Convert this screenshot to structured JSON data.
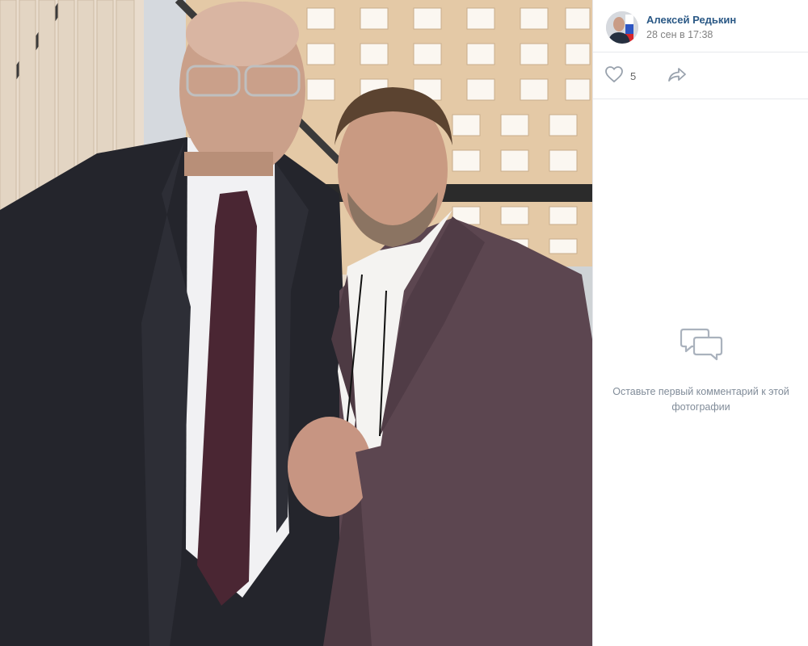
{
  "post": {
    "author_name": "Алексей Редькин",
    "date": "28 сен в 17:38",
    "likes": "5"
  },
  "comments": {
    "empty_text": "Оставьте первый комментарий к этой фотографии"
  },
  "icons": {
    "like": "heart-icon",
    "share": "share-arrow-icon",
    "empty_comments": "speech-bubble-icon"
  },
  "colors": {
    "link": "#2a5885",
    "secondary_text": "#828282",
    "icon": "#99a2ad"
  }
}
